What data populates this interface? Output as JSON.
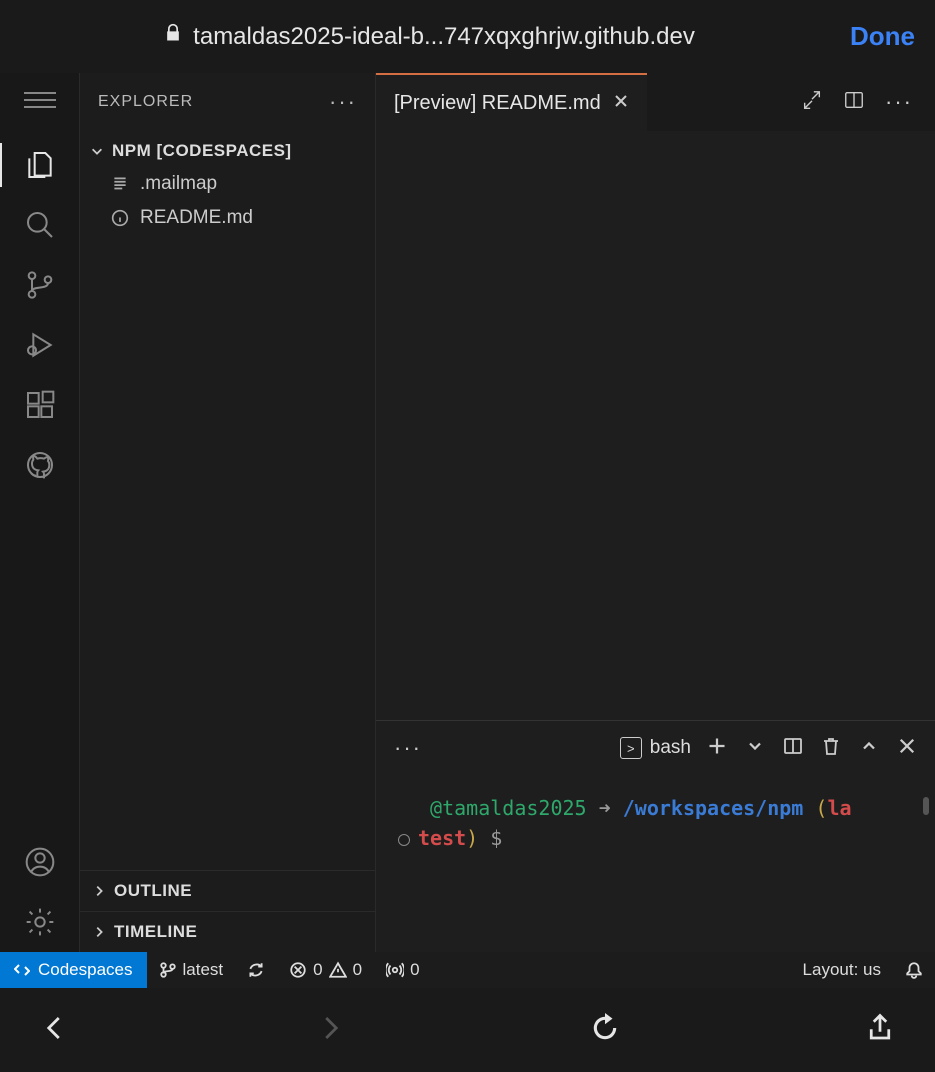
{
  "browser": {
    "url": "tamaldas2025-ideal-b...747xqxghrjw.github.dev",
    "done": "Done"
  },
  "sidebar": {
    "title": "EXPLORER",
    "root": "NPM [CODESPACES]",
    "items": [
      {
        "name": ".mailmap",
        "icon": "lines"
      },
      {
        "name": "README.md",
        "icon": "info"
      }
    ],
    "sections": [
      {
        "label": "OUTLINE"
      },
      {
        "label": "TIMELINE"
      }
    ]
  },
  "tabs": {
    "active": "[Preview] README.md"
  },
  "terminal": {
    "shell": "bash",
    "user": "@tamaldas2025",
    "arrow": "➜",
    "path": "/workspaces/npm",
    "branch_open": "(",
    "branch1": "la",
    "branch2": "test",
    "branch_close": ")",
    "prompt": "$"
  },
  "status": {
    "codespaces": "Codespaces",
    "branch": "latest",
    "errors": "0",
    "warnings": "0",
    "ports": "0",
    "layout": "Layout: us"
  }
}
